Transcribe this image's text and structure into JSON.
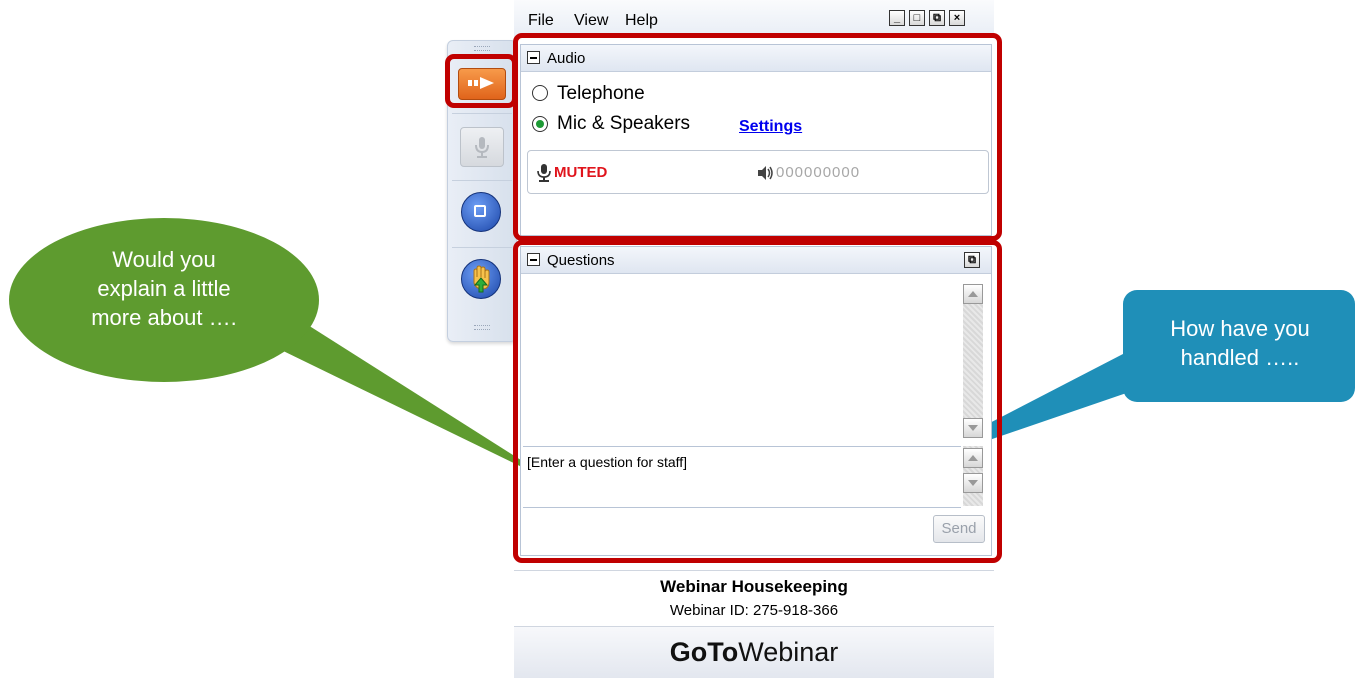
{
  "menu": {
    "file": "File",
    "view": "View",
    "help": "Help"
  },
  "window_controls": [
    "minimize-button",
    "restore-button",
    "detach-button",
    "close-button"
  ],
  "audio": {
    "title": "Audio",
    "option_telephone": "Telephone",
    "option_mic": "Mic & Speakers",
    "selected": "Mic & Speakers",
    "settings_link": "Settings",
    "mic_status": "MUTED",
    "speaker_level": "000000000"
  },
  "questions": {
    "title": "Questions",
    "input_value": "[Enter a question for staff]",
    "send_label": "Send"
  },
  "footer": {
    "title": "Webinar Housekeeping",
    "webinar_id": "Webinar ID: 275-918-366",
    "brand_bold": "GoTo",
    "brand_light": "Webinar"
  },
  "callouts": {
    "left": "Would you explain a little more about ….",
    "right": "How have you handled ….."
  },
  "colors": {
    "highlight_frame": "#c00000",
    "left_bubble": "#5e9b2f",
    "right_bubble": "#1f8fb8",
    "muted": "#e0141c",
    "radio_selected": "#1d9a35",
    "toolbar_arrow": "#e8731f"
  },
  "icons": [
    "grip-icon",
    "arrow-icon",
    "microphone-icon",
    "stop-icon",
    "raise-hand-icon",
    "speaker-icon",
    "collapse-icon",
    "popout-icon",
    "scroll-up-icon",
    "scroll-down-icon"
  ]
}
